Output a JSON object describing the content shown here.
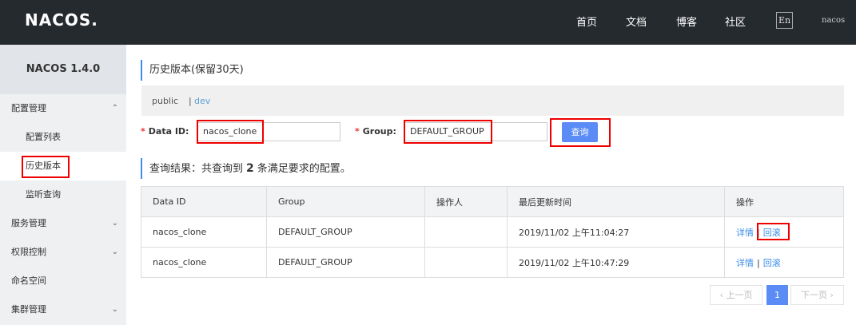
{
  "header": {
    "logo": "NACOS.",
    "nav": [
      "首页",
      "文档",
      "博客",
      "社区"
    ],
    "lang": "En",
    "user": "nacos"
  },
  "sidebar": {
    "version": "NACOS 1.4.0",
    "items": [
      {
        "label": "配置管理",
        "chevron": "chevron-up"
      },
      {
        "label": "配置列表"
      },
      {
        "label": "历史版本"
      },
      {
        "label": "监听查询"
      },
      {
        "label": "服务管理",
        "chevron": "chevron-down"
      },
      {
        "label": "权限控制",
        "chevron": "chevron-down"
      },
      {
        "label": "命名空间"
      },
      {
        "label": "集群管理",
        "chevron": "chevron-down"
      }
    ]
  },
  "main": {
    "title": "历史版本(保留30天)",
    "namespaces": {
      "public": "public",
      "separator": "|",
      "dev": "dev"
    },
    "form": {
      "dataid_label": "Data ID:",
      "dataid_value": "nacos_clone",
      "group_label": "Group:",
      "group_value": "DEFAULT_GROUP",
      "required_mark": "*",
      "query_button": "查询"
    },
    "result": {
      "prefix": "查询结果：共查询到",
      "count": "2",
      "suffix": "条满足要求的配置。"
    },
    "table": {
      "headers": [
        "Data ID",
        "Group",
        "操作人",
        "最后更新时间",
        "操作"
      ],
      "rows": [
        {
          "dataid": "nacos_clone",
          "group": "DEFAULT_GROUP",
          "operator": "",
          "updated": "2019/11/02 上午11:04:27",
          "detail": "详情",
          "rollback": "回滚"
        },
        {
          "dataid": "nacos_clone",
          "group": "DEFAULT_GROUP",
          "operator": "",
          "updated": "2019/11/02 上午10:47:29",
          "detail": "详情",
          "rollback": "回滚"
        }
      ]
    },
    "pagination": {
      "prev": "上一页",
      "current": "1",
      "next": "下一页"
    }
  },
  "colors": {
    "accent": "#5b8cf6",
    "highlight": "#e00000",
    "topbar": "#252a2f"
  }
}
